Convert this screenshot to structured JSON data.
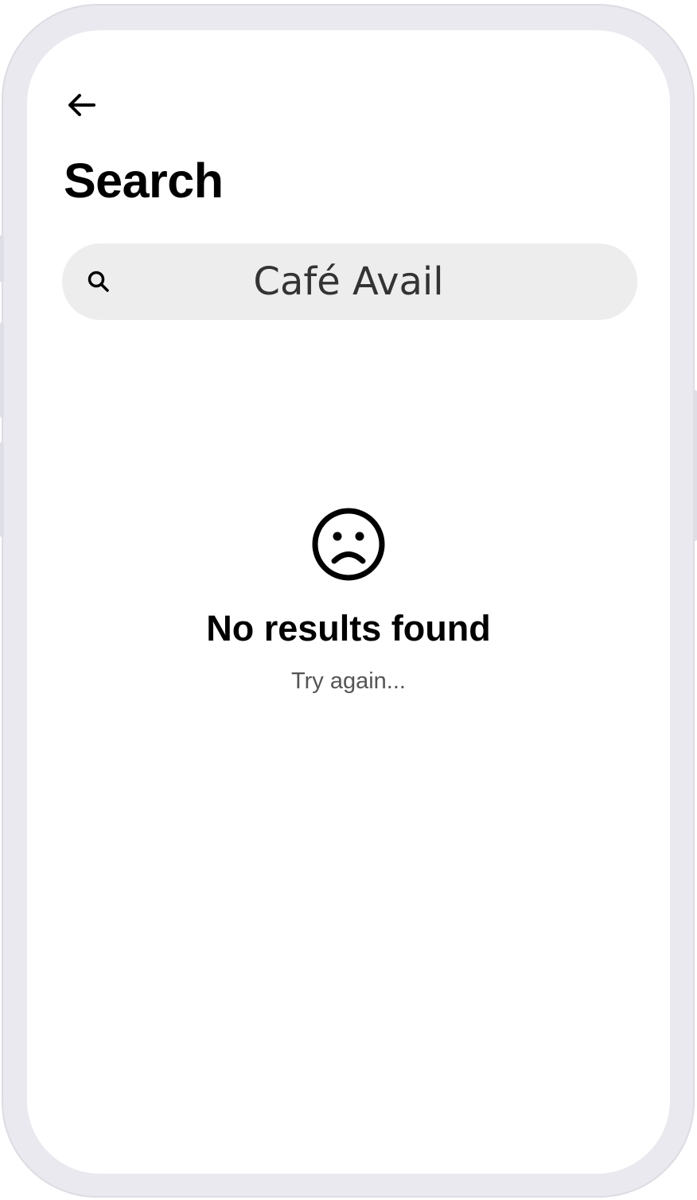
{
  "header": {
    "back_icon": "arrow-left-icon",
    "title": "Search"
  },
  "search": {
    "icon": "search-icon",
    "value": "Café Avail"
  },
  "empty_state": {
    "icon": "sad-face-icon",
    "title": "No results found",
    "subtitle": "Try again..."
  },
  "colors": {
    "frame": "#e9e9ef",
    "screen": "#ffffff",
    "search_bg": "#ededed",
    "text_primary": "#000000",
    "text_secondary": "#555555"
  }
}
